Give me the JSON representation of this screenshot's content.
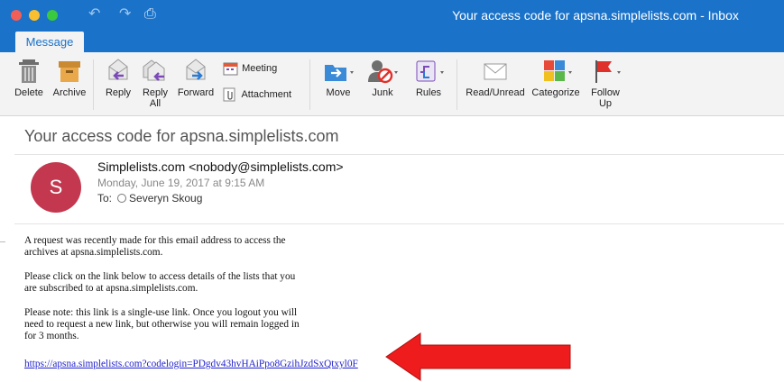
{
  "window": {
    "title": "Your access code for apsna.simplelists.com - Inbox",
    "active_tab": "Message"
  },
  "ribbon": {
    "delete": "Delete",
    "archive": "Archive",
    "reply": "Reply",
    "reply_all_1": "Reply",
    "reply_all_2": "All",
    "forward": "Forward",
    "meeting": "Meeting",
    "attachment": "Attachment",
    "move": "Move",
    "junk": "Junk",
    "rules": "Rules",
    "read_unread": "Read/Unread",
    "categorize": "Categorize",
    "follow_up_1": "Follow",
    "follow_up_2": "Up"
  },
  "email": {
    "subject": "Your access code for apsna.simplelists.com",
    "avatar_letter": "S",
    "sender": "Simplelists.com <nobody@simplelists.com>",
    "date": "Monday, June 19, 2017 at 9:15 AM",
    "to_label": "To:",
    "to_name": "Severyn Skoug",
    "body_p1_l1": "A request was recently made for this email address to access the",
    "body_p1_l2": "archives at apsna.simplelists.com.",
    "body_p2_l1": "Please click on the link below to access details of the lists that you",
    "body_p2_l2": "are subscribed to at apsna.simplelists.com.",
    "body_p3_l1": "Please note: this link is a single-use link. Once you logout you will",
    "body_p3_l2": "need to request a new link, but otherwise you will remain logged in",
    "body_p3_l3": "for 3 months.",
    "link": "https://apsna.simplelists.com?codelogin=PDgdv43hvHAiPpo8GzihJzdSxQtxyl0F"
  },
  "colors": {
    "titlebar": "#1a72c9",
    "avatar": "#c3374f",
    "arrow": "#ee1c1c"
  }
}
